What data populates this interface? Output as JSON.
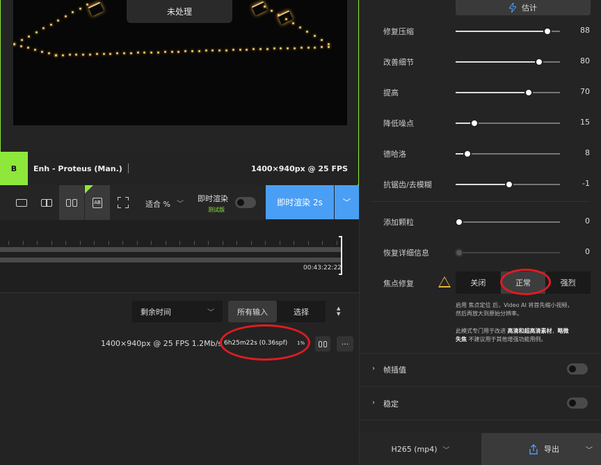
{
  "preview": {
    "overlay_label": "未处理",
    "badge": "B",
    "model_name": "Enh - Proteus (Man.)",
    "resolution": "1400×940px @ 25 FPS"
  },
  "toolbar": {
    "fit_label": "适合 %",
    "realtime_label": "即时渲染",
    "trial_label": "测试版",
    "realtime_on": false,
    "render_button": "即时渲染 2s"
  },
  "timeline": {
    "end_time": "00:43:22:22"
  },
  "queue": {
    "sort_select": "剩余时间",
    "tabs": [
      {
        "label": "所有输入",
        "active": true
      },
      {
        "label": "选择",
        "active": false
      }
    ],
    "job": {
      "info": "1400×940px @ 25 FPS  1.2Mb/s",
      "time": "6h25m22s (0.36spf)",
      "percent": "1%",
      "more": "···"
    }
  },
  "panel": {
    "estimate_label": "估计",
    "sliders": [
      {
        "label": "修复压缩",
        "value": 88,
        "fraction": 0.88,
        "value_text": "88"
      },
      {
        "label": "改善细节",
        "value": 80,
        "fraction": 0.8,
        "value_text": "80"
      },
      {
        "label": "提高",
        "value": 70,
        "fraction": 0.7,
        "value_text": "70"
      },
      {
        "label": "降低噪点",
        "value": 15,
        "fraction": 0.18,
        "value_text": "15"
      },
      {
        "label": "德哈洛",
        "value": 8,
        "fraction": 0.11,
        "value_text": "8"
      },
      {
        "label": "抗锯齿/去模糊",
        "value": -1,
        "fraction": 0.51,
        "value_text": "-1"
      },
      {
        "label": "添加颗粒",
        "value": 0,
        "fraction": 0.03,
        "value_text": "0"
      },
      {
        "label": "恢复详细信息",
        "value": 0,
        "fraction": 0.03,
        "value_text": "0",
        "disabled": true
      }
    ],
    "focus": {
      "label": "焦点修复",
      "options": [
        {
          "label": "关闭",
          "active": false
        },
        {
          "label": "正常",
          "active": true
        },
        {
          "label": "强烈",
          "active": false
        }
      ],
      "note1_a": "启用 焦点定位 后，Video AI 将首先缩小视频，",
      "note1_b": "然后再放大到原始分辨率。",
      "note2_a": "此模式专门用于改进 ",
      "note2_bold1": "高清和超高清素材",
      "note2_b": "，",
      "note2_bold2": "略微",
      "note2_bold3": "失焦",
      "note2_c": " 不建议用于其他增强功能用例。"
    },
    "sections": [
      {
        "label": "帧插值",
        "enabled": false
      },
      {
        "label": "稳定",
        "enabled": false
      }
    ],
    "footer": {
      "format": "H265 (mp4)",
      "export": "导出"
    }
  }
}
